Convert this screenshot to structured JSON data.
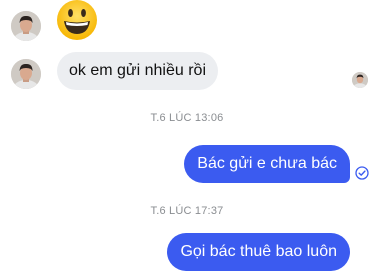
{
  "conversation": {
    "messages": [
      {
        "sender": "contact",
        "type": "emoji",
        "content": "grinning-face-emoji"
      },
      {
        "sender": "contact",
        "type": "text",
        "text": "ok em gửi nhiều rồi"
      },
      {
        "type": "timestamp",
        "text": "T.6 LÚC 13:06"
      },
      {
        "sender": "me",
        "type": "text",
        "text": "Bác gửi e chưa bác"
      },
      {
        "type": "timestamp",
        "text": "T.6 LÚC 17:37"
      },
      {
        "sender": "me",
        "type": "text",
        "text": "Gọi bác thuê bao luôn"
      }
    ],
    "colors": {
      "outgoing_bubble": "#3b5bf0",
      "incoming_bubble": "#eceef1",
      "timestamp_text": "#8a8d91",
      "background": "#ffffff"
    },
    "icons": {
      "read_receipt": "contact-avatar-mini",
      "delivered": "check-circle-icon"
    }
  }
}
